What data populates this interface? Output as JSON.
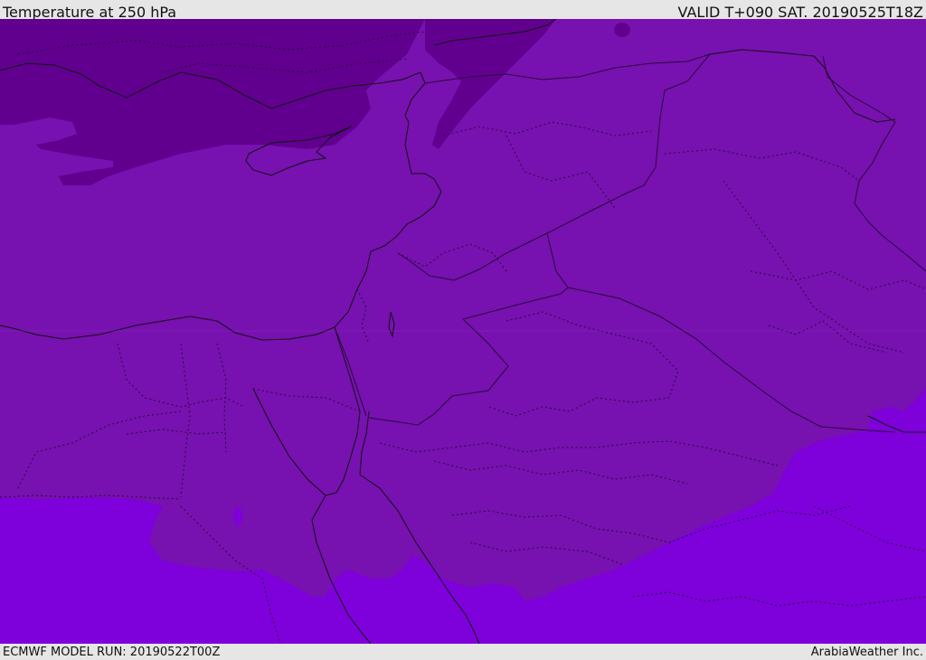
{
  "header": {
    "title": "Temperature at 250 hPa",
    "valid": "VALID T+090 SAT. 20190525T18Z"
  },
  "footer": {
    "model_run": "ECMWF MODEL RUN: 20190522T00Z",
    "credit": "ArabiaWeather Inc."
  },
  "colors": {
    "band_cold": "#61008f",
    "band_mid": "#7711b0",
    "band_warm": "#7e00db",
    "coast_line": "#111111",
    "border_line": "#2a0a3a"
  }
}
